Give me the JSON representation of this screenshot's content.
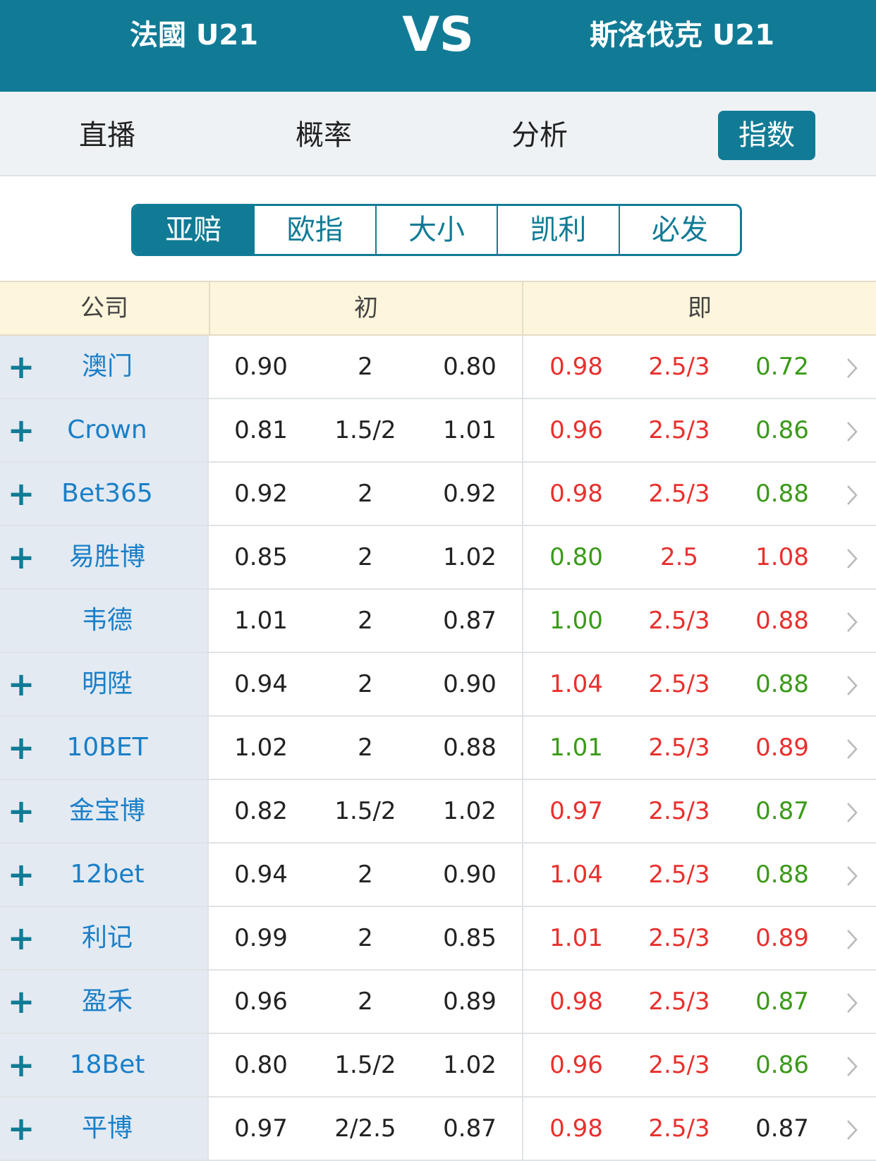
{
  "match": {
    "home": "法國 U21",
    "vs": "VS",
    "away": "斯洛伐克 U21"
  },
  "nav_tabs": [
    {
      "label": "直播",
      "active": false
    },
    {
      "label": "概率",
      "active": false
    },
    {
      "label": "分析",
      "active": false
    },
    {
      "label": "指数",
      "active": true
    }
  ],
  "sub_tabs": [
    {
      "label": "亚赔",
      "active": true
    },
    {
      "label": "欧指",
      "active": false
    },
    {
      "label": "大小",
      "active": false
    },
    {
      "label": "凯利",
      "active": false
    },
    {
      "label": "必发",
      "active": false
    }
  ],
  "table": {
    "headers": {
      "company": "公司",
      "initial": "初",
      "live": "即"
    },
    "rows": [
      {
        "plus": true,
        "company": "澳门",
        "init": [
          "0.90",
          "2",
          "0.80"
        ],
        "live": [
          "0.98",
          "2.5/3",
          "0.72"
        ],
        "live_colors": [
          "red",
          "red",
          "green"
        ]
      },
      {
        "plus": true,
        "company": "Crown",
        "init": [
          "0.81",
          "1.5/2",
          "1.01"
        ],
        "live": [
          "0.96",
          "2.5/3",
          "0.86"
        ],
        "live_colors": [
          "red",
          "red",
          "green"
        ]
      },
      {
        "plus": true,
        "company": "Bet365",
        "init": [
          "0.92",
          "2",
          "0.92"
        ],
        "live": [
          "0.98",
          "2.5/3",
          "0.88"
        ],
        "live_colors": [
          "red",
          "red",
          "green"
        ]
      },
      {
        "plus": true,
        "company": "易胜博",
        "init": [
          "0.85",
          "2",
          "1.02"
        ],
        "live": [
          "0.80",
          "2.5",
          "1.08"
        ],
        "live_colors": [
          "green",
          "red",
          "red"
        ]
      },
      {
        "plus": false,
        "company": "韦德",
        "init": [
          "1.01",
          "2",
          "0.87"
        ],
        "live": [
          "1.00",
          "2.5/3",
          "0.88"
        ],
        "live_colors": [
          "green",
          "red",
          "red"
        ]
      },
      {
        "plus": true,
        "company": "明陞",
        "init": [
          "0.94",
          "2",
          "0.90"
        ],
        "live": [
          "1.04",
          "2.5/3",
          "0.88"
        ],
        "live_colors": [
          "red",
          "red",
          "green"
        ]
      },
      {
        "plus": true,
        "company": "10BET",
        "init": [
          "1.02",
          "2",
          "0.88"
        ],
        "live": [
          "1.01",
          "2.5/3",
          "0.89"
        ],
        "live_colors": [
          "green",
          "red",
          "red"
        ]
      },
      {
        "plus": true,
        "company": "金宝博",
        "init": [
          "0.82",
          "1.5/2",
          "1.02"
        ],
        "live": [
          "0.97",
          "2.5/3",
          "0.87"
        ],
        "live_colors": [
          "red",
          "red",
          "green"
        ]
      },
      {
        "plus": true,
        "company": "12bet",
        "init": [
          "0.94",
          "2",
          "0.90"
        ],
        "live": [
          "1.04",
          "2.5/3",
          "0.88"
        ],
        "live_colors": [
          "red",
          "red",
          "green"
        ]
      },
      {
        "plus": true,
        "company": "利记",
        "init": [
          "0.99",
          "2",
          "0.85"
        ],
        "live": [
          "1.01",
          "2.5/3",
          "0.89"
        ],
        "live_colors": [
          "red",
          "red",
          "red"
        ]
      },
      {
        "plus": true,
        "company": "盈禾",
        "init": [
          "0.96",
          "2",
          "0.89"
        ],
        "live": [
          "0.98",
          "2.5/3",
          "0.87"
        ],
        "live_colors": [
          "red",
          "red",
          "green"
        ]
      },
      {
        "plus": true,
        "company": "18Bet",
        "init": [
          "0.80",
          "1.5/2",
          "1.02"
        ],
        "live": [
          "0.96",
          "2.5/3",
          "0.86"
        ],
        "live_colors": [
          "red",
          "red",
          "green"
        ]
      },
      {
        "plus": true,
        "company": "平博",
        "init": [
          "0.97",
          "2/2.5",
          "0.87"
        ],
        "live": [
          "0.98",
          "2.5/3",
          "0.87"
        ],
        "live_colors": [
          "red",
          "red",
          "dark"
        ]
      }
    ]
  },
  "colors": {
    "primary": "#117b96",
    "up": "#e8302d",
    "down": "#3a9a18",
    "company_link": "#1a7fc8"
  },
  "icons": {
    "expand": "plus-icon",
    "detail": "chevron-right-icon"
  }
}
